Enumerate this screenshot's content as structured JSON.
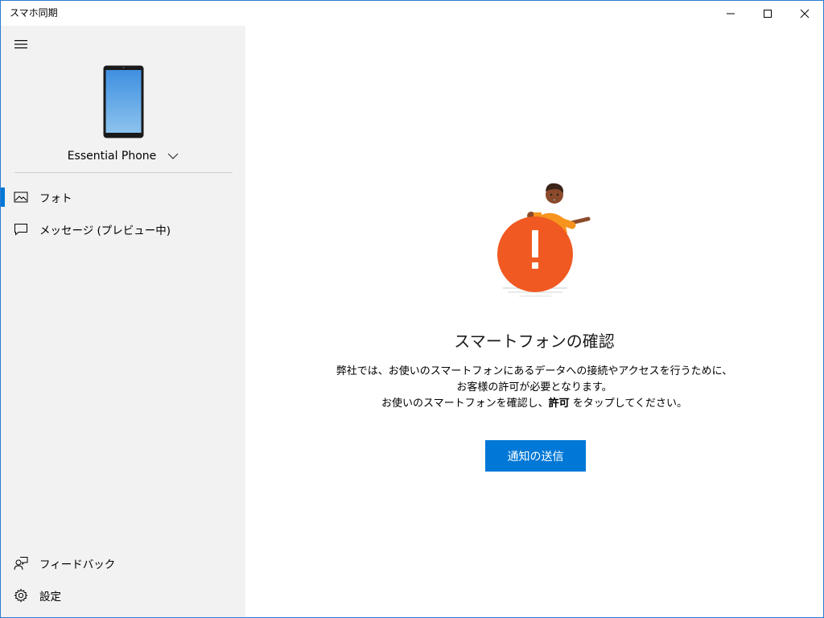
{
  "window": {
    "title": "スマホ同期"
  },
  "sidebar": {
    "device_name": "Essential Phone",
    "nav": [
      {
        "label": "フォト",
        "icon": "photos-icon",
        "selected": true
      },
      {
        "label": "メッセージ (プレビュー中)",
        "icon": "message-icon",
        "selected": false
      }
    ],
    "bottom": [
      {
        "label": "フィードバック",
        "icon": "feedback-icon"
      },
      {
        "label": "設定",
        "icon": "gear-icon"
      }
    ]
  },
  "main": {
    "heading": "スマートフォンの確認",
    "description_line1": "弊社では、お使いのスマートフォンにあるデータへの接続やアクセスを行うために、",
    "description_line2": "お客様の許可が必要となります。",
    "description_line3_pre": "お使いのスマートフォンを確認し、",
    "description_line3_bold": "許可",
    "description_line3_post": " をタップしてください。",
    "button_label": "通知の送信"
  },
  "colors": {
    "accent": "#0078d7",
    "alert_orange": "#f05a22",
    "sidebar_bg": "#f2f2f2"
  }
}
